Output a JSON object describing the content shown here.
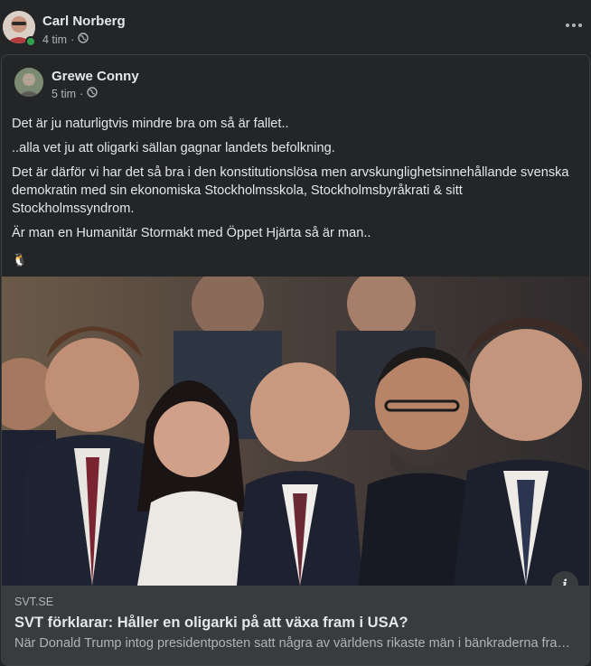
{
  "post": {
    "author": "Carl Norberg",
    "time": "4 tim",
    "separator": "·",
    "audience_icon": "globe-icon",
    "more_icon": "more-options-icon"
  },
  "shared_post": {
    "author": "Grewe Conny",
    "time": "5 tim",
    "separator": "·",
    "audience_icon": "globe-icon",
    "paragraphs": [
      "Det är ju naturligtvis mindre bra om så är fallet..",
      "..alla vet ju att oligarki sällan gagnar landets befolkning.",
      "Det är därför vi har det så bra i den konstitutionslösa men arvskunglighetsinnehållande svenska demokratin med sin ekonomiska Stockholmsskola, Stockholmsbyråkrati & sitt Stockholmssyndrom.",
      "Är man en Humanitär Stormakt med Öppet Hjärta så är man.."
    ],
    "emoji": "🐧"
  },
  "link": {
    "domain": "SVT.SE",
    "title": "SVT förklarar: Håller en oligarki på att växa fram i USA?",
    "description": "När Donald Trump intog presidentposten satt några av världens rikaste män i bänkraderna framför honom",
    "info_icon": "info-icon"
  },
  "colors": {
    "background": "#242526",
    "text_primary": "#e4e6eb",
    "text_secondary": "#b0b3b8",
    "online": "#31a24c",
    "link_box": "#3a3b3c"
  }
}
